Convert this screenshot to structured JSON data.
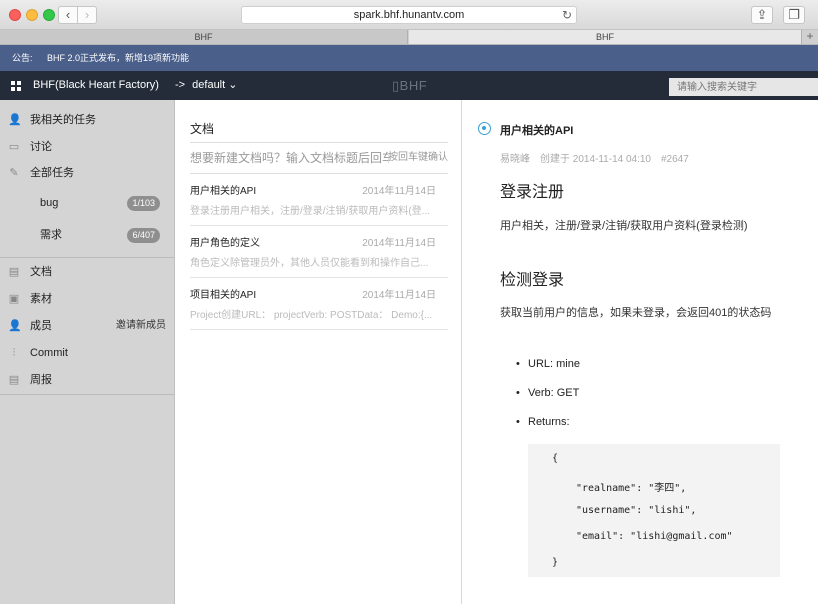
{
  "browser": {
    "url": "spark.bhf.hunantv.com",
    "tabs": [
      "BHF",
      "BHF"
    ],
    "new_tab": "+"
  },
  "announce": {
    "label": "公告:",
    "text": "BHF 2.0正式发布，新增19项新功能"
  },
  "header": {
    "app_title": "BHF(Black Heart Factory)",
    "project_arrow": "->",
    "project": "default",
    "logo": "BHF",
    "search_placeholder": "请输入搜索关键字"
  },
  "sidebar": {
    "my_tasks": "我相关的任务",
    "discussion": "讨论",
    "all_tasks": "全部任务",
    "sub": [
      {
        "label": "bug",
        "badge": "1/103"
      },
      {
        "label": "需求",
        "badge": "6/407"
      }
    ],
    "docs": "文档",
    "assets": "素材",
    "members": "成员",
    "invite": "邀请新成员",
    "commit": "Commit",
    "weekly": "周报"
  },
  "middle": {
    "title": "文档",
    "new_doc_placeholder": "想要新建文档吗？输入文档标题后回车",
    "new_doc_hint": "按回车键确认",
    "docs": [
      {
        "title": "用户相关的API",
        "date": "2014年11月14日",
        "excerpt": "登录注册用户相关，注册/登录/注销/获取用户资料(登..."
      },
      {
        "title": "用户角色的定义",
        "date": "2014年11月14日",
        "excerpt": "角色定义除管理员外，其他人员仅能看到和操作自己..."
      },
      {
        "title": "项目相关的API",
        "date": "2014年11月14日",
        "excerpt": "Project创建URL： projectVerb: POSTData： Demo:{..."
      }
    ]
  },
  "doc": {
    "title": "用户相关的API",
    "author": "易晓峰",
    "created": "创建于 2014-11-14 04:10",
    "id": "#2647",
    "h1": "登录注册",
    "p1": "用户相关，注册/登录/注销/获取用户资料(登录检测)",
    "h2": "检测登录",
    "p2": "获取当前用户的信息，如果未登录，会返回401的状态码",
    "list": [
      "URL: mine",
      "Verb: GET",
      "Returns:"
    ],
    "code": [
      "{",
      "\"realname\": \"李四\",",
      "\"username\": \"lishi\",",
      "\"email\": \"lishi@gmail.com\"",
      "}"
    ]
  }
}
